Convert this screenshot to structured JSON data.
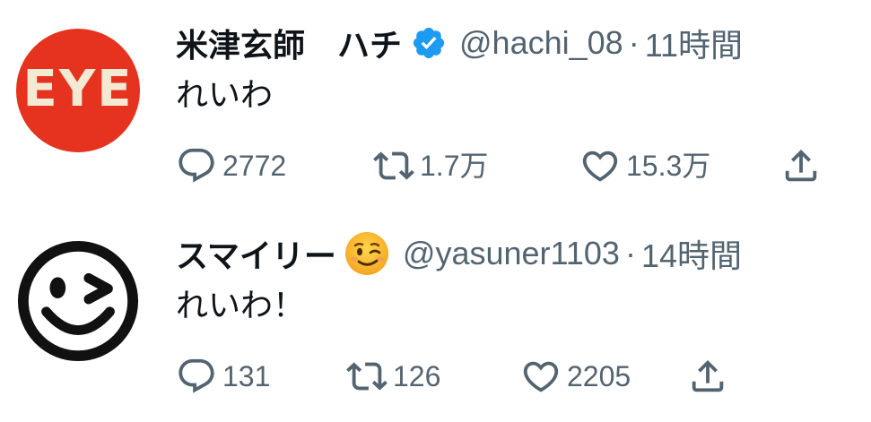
{
  "tweets": [
    {
      "avatar_text": "EYE",
      "name": "米津玄師　ハチ",
      "verified": true,
      "handle": "@hachi_08",
      "separator": "·",
      "time": "11時間",
      "text": "れいわ",
      "reply_count": "2772",
      "retweet_count": "1.7万",
      "like_count": "15.3万"
    },
    {
      "name": "スマイリー",
      "emoji": "winking-face",
      "handle": "@yasuner1103",
      "separator": "·",
      "time": "14時間",
      "text": "れいわ！",
      "reply_count": "131",
      "retweet_count": "126",
      "like_count": "2205"
    }
  ],
  "colors": {
    "verified_blue": "#1d9bf0",
    "secondary_text": "#536471",
    "eye_avatar_red": "#e5331f"
  },
  "icons": [
    "reply-icon",
    "retweet-icon",
    "like-icon",
    "share-icon",
    "verified-badge-icon"
  ]
}
